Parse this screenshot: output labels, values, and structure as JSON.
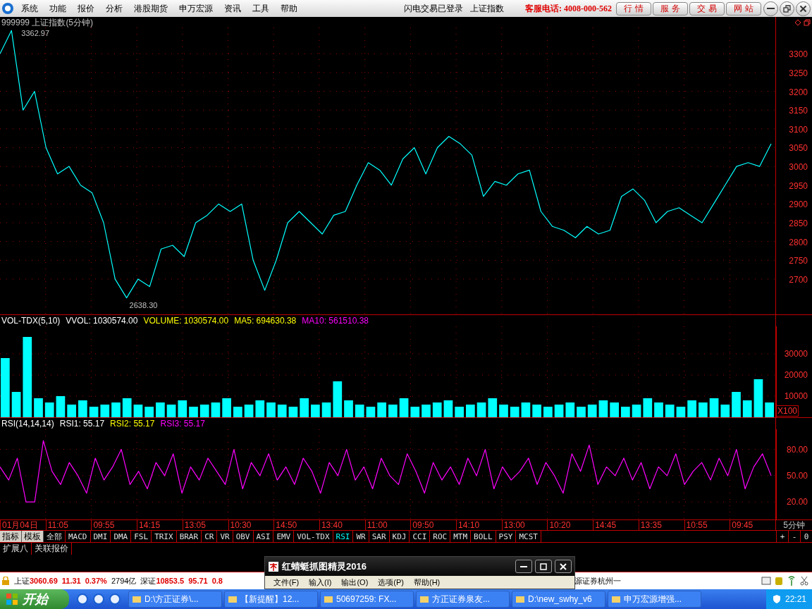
{
  "menu": {
    "items": [
      "系统",
      "功能",
      "报价",
      "分析",
      "港股期货",
      "申万宏源",
      "资讯",
      "工具",
      "帮助"
    ],
    "login_status": "闪电交易已登录",
    "current_symbol": "上证指数",
    "hotline": "客服电话: 4008-000-562",
    "buttons": [
      "行 情",
      "服 务",
      "交 易",
      "网 站"
    ]
  },
  "price_panel": {
    "title": "999999 上证指数(5分钟)",
    "chart_data": {
      "type": "line",
      "grid": true,
      "ylim": [
        2606,
        3370
      ],
      "yticks": [
        2700,
        2750,
        2800,
        2850,
        2900,
        2950,
        3000,
        3050,
        3100,
        3150,
        3200,
        3250,
        3300
      ],
      "series": [
        {
          "color": "#00ffff",
          "values": [
            3300,
            3362,
            3150,
            3200,
            3050,
            2980,
            3000,
            2950,
            2930,
            2850,
            2700,
            2650,
            2700,
            2680,
            2780,
            2790,
            2760,
            2850,
            2870,
            2900,
            2880,
            2900,
            2750,
            2670,
            2750,
            2850,
            2880,
            2850,
            2820,
            2870,
            2880,
            2950,
            3010,
            2990,
            2950,
            3020,
            3050,
            2980,
            3050,
            3080,
            3060,
            3030,
            2920,
            2960,
            2950,
            2980,
            2990,
            2880,
            2840,
            2830,
            2810,
            2840,
            2820,
            2830,
            2920,
            2940,
            2910,
            2850,
            2880,
            2890,
            2870,
            2850,
            2900,
            2950,
            3000,
            3010,
            3000,
            3060
          ]
        }
      ],
      "annotations": [
        {
          "text": "3362.97"
        },
        {
          "text": "2638.30"
        }
      ]
    }
  },
  "volume_panel": {
    "legend": [
      {
        "label": "VOL-TDX(5,10)",
        "color": "#ffffff"
      },
      {
        "label": "VVOL: 1030574.00",
        "color": "#ffffff"
      },
      {
        "label": "VOLUME: 1030574.00",
        "color": "#ffff00"
      },
      {
        "label": "MA5: 694630.38",
        "color": "#ffff00"
      },
      {
        "label": "MA10: 561510.38",
        "color": "#ff00ff"
      }
    ],
    "unit": "X100",
    "chart_data": {
      "type": "bar",
      "grid": true,
      "ylim": [
        0,
        43000
      ],
      "yticks": [
        10000,
        20000,
        30000
      ],
      "series": [
        {
          "color": "#00ffff",
          "values": [
            28000,
            12000,
            38000,
            9000,
            7000,
            10000,
            6000,
            8000,
            5000,
            6000,
            7000,
            9000,
            6000,
            5000,
            7000,
            6000,
            8000,
            5000,
            6000,
            7000,
            9000,
            5000,
            6000,
            8000,
            7000,
            6000,
            5000,
            9000,
            6000,
            7000,
            17000,
            8000,
            6000,
            5000,
            7000,
            6000,
            9000,
            5000,
            6000,
            7000,
            8000,
            5000,
            6000,
            7000,
            9000,
            6000,
            5000,
            7000,
            6000,
            5000,
            6000,
            7000,
            5000,
            6000,
            8000,
            7000,
            5000,
            6000,
            9000,
            7000,
            6000,
            5000,
            8000,
            7000,
            9000,
            6000,
            12000,
            8000,
            18000,
            7000
          ]
        }
      ]
    }
  },
  "rsi_panel": {
    "legend": [
      {
        "label": "RSI(14,14,14)",
        "color": "#ffffff"
      },
      {
        "label": "RSI1: 55.17",
        "color": "#ffffff"
      },
      {
        "label": "RSI2: 55.17",
        "color": "#ffff00"
      },
      {
        "label": "RSI3: 55.17",
        "color": "#ff00ff"
      }
    ],
    "chart_data": {
      "type": "line",
      "grid": true,
      "ylim": [
        0,
        103
      ],
      "yticks": [
        {
          "value": 20,
          "label": "20.00"
        },
        {
          "value": 50,
          "label": "50.00"
        },
        {
          "value": 80,
          "label": "80.00"
        }
      ],
      "series": [
        {
          "color": "#ff00ff",
          "values": [
            60,
            45,
            70,
            20,
            20,
            90,
            55,
            40,
            65,
            50,
            30,
            70,
            45,
            60,
            80,
            40,
            55,
            35,
            65,
            50,
            75,
            30,
            60,
            45,
            70,
            55,
            40,
            80,
            35,
            65,
            50,
            75,
            45,
            60,
            40,
            70,
            55,
            30,
            65,
            50,
            80,
            45,
            60,
            35,
            70,
            50,
            40,
            75,
            55,
            30,
            65,
            45,
            60,
            40,
            70,
            50,
            80,
            35,
            60,
            45,
            55,
            70,
            40,
            65,
            50,
            30,
            75,
            55,
            85,
            40,
            60,
            50,
            70,
            45,
            65,
            35,
            60,
            50,
            75,
            40,
            55,
            65,
            45,
            70,
            50,
            80,
            35,
            60,
            75,
            50
          ]
        }
      ]
    }
  },
  "time_axis": {
    "labels": [
      "01月04日",
      "11:05",
      "09:55",
      "14:15",
      "13:05",
      "10:30",
      "14:50",
      "13:40",
      "11:00",
      "09:50",
      "14:10",
      "13:00",
      "10:20",
      "14:45",
      "13:35",
      "10:55",
      "09:45"
    ],
    "period": "5分钟"
  },
  "indicator_tabs": {
    "modes": [
      "指标",
      "模板"
    ],
    "tabs": [
      {
        "label": "全部",
        "selected": false
      },
      {
        "label": "MACD",
        "selected": false
      },
      {
        "label": "DMI",
        "selected": false
      },
      {
        "label": "DMA",
        "selected": false
      },
      {
        "label": "FSL",
        "selected": false
      },
      {
        "label": "TRIX",
        "selected": false
      },
      {
        "label": "BRAR",
        "selected": false
      },
      {
        "label": "CR",
        "selected": false
      },
      {
        "label": "VR",
        "selected": false
      },
      {
        "label": "OBV",
        "selected": false
      },
      {
        "label": "ASI",
        "selected": false
      },
      {
        "label": "EMV",
        "selected": false
      },
      {
        "label": "VOL-TDX",
        "selected": false
      },
      {
        "label": "RSI",
        "selected": true
      },
      {
        "label": "WR",
        "selected": false
      },
      {
        "label": "SAR",
        "selected": false
      },
      {
        "label": "KDJ",
        "selected": false
      },
      {
        "label": "CCI",
        "selected": false
      },
      {
        "label": "ROC",
        "selected": false
      },
      {
        "label": "MTM",
        "selected": false
      },
      {
        "label": "BOLL",
        "selected": false
      },
      {
        "label": "PSY",
        "selected": false
      },
      {
        "label": "MCST",
        "selected": false
      }
    ],
    "zoom_buttons": [
      "+",
      "-",
      "0"
    ]
  },
  "extra_tabs": [
    "扩展八",
    "关联报价"
  ],
  "status_bar": {
    "items": [
      {
        "label": "上证",
        "value": "3060.69"
      },
      {
        "value": "11.31"
      },
      {
        "value": "0.37%"
      },
      {
        "label": "2794亿"
      },
      {
        "label": "深证",
        "value": "10853.5"
      },
      {
        "value": "95.71"
      },
      {
        "value": "0.8"
      }
    ],
    "broker": "源证券杭州一"
  },
  "capture_window": {
    "title": "红蜻蜓抓图精灵2016",
    "menu": [
      "文件(F)",
      "输入(I)",
      "输出(O)",
      "选项(P)",
      "帮助(H)"
    ]
  },
  "taskbar": {
    "start": "开始",
    "tasks": [
      "D:\\方正证券\\...",
      "【新提醒】12...",
      "50697259: FX...",
      "方正证券泉友...",
      "D:\\new_swhy_v6",
      "申万宏源增强..."
    ],
    "clock": "22:21"
  }
}
